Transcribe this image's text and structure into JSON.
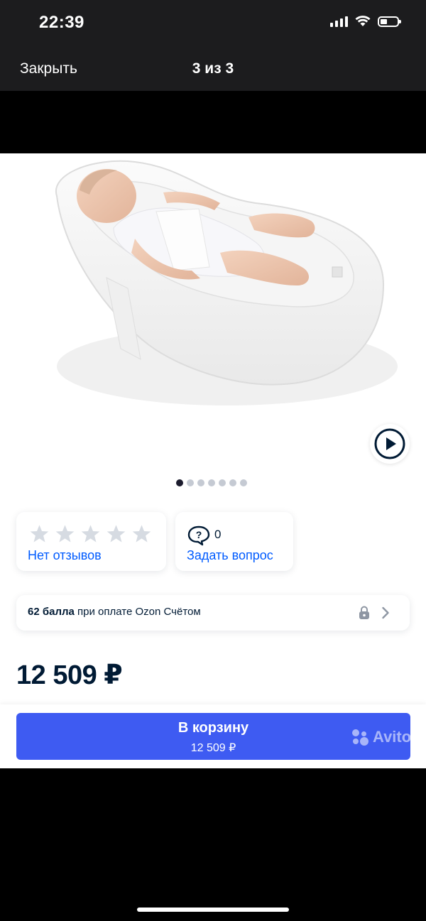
{
  "status_bar": {
    "time": "22:39"
  },
  "viewer": {
    "close_label": "Закрыть",
    "page_counter": "3 из 3"
  },
  "gallery": {
    "image_alt": "baby-cocoon-nest-photo",
    "dots_total": 7,
    "active_dot": 1
  },
  "reviews": {
    "rating_stars": 0,
    "rating_max": 5,
    "link_label": "Нет отзывов"
  },
  "questions": {
    "count": "0",
    "link_label": "Задать вопрос"
  },
  "points_banner": {
    "points_bold": "62 балла",
    "points_rest": " при оплате Ozon Счётом"
  },
  "product": {
    "price": "12 509 ₽"
  },
  "cart_button": {
    "label": "В корзину",
    "price": "12 509 ₽"
  },
  "watermark": {
    "text": "Avito"
  },
  "colors": {
    "accent_blue": "#005bff",
    "cart_button": "#3e5bf2",
    "text_dark": "#001a34",
    "star_empty": "#d6dbe2"
  },
  "icons": {
    "video": "play-circle-icon",
    "question": "speech-bubble-question-icon",
    "lock": "lock-icon",
    "chevron": "chevron-right-icon",
    "star": "star-icon"
  }
}
